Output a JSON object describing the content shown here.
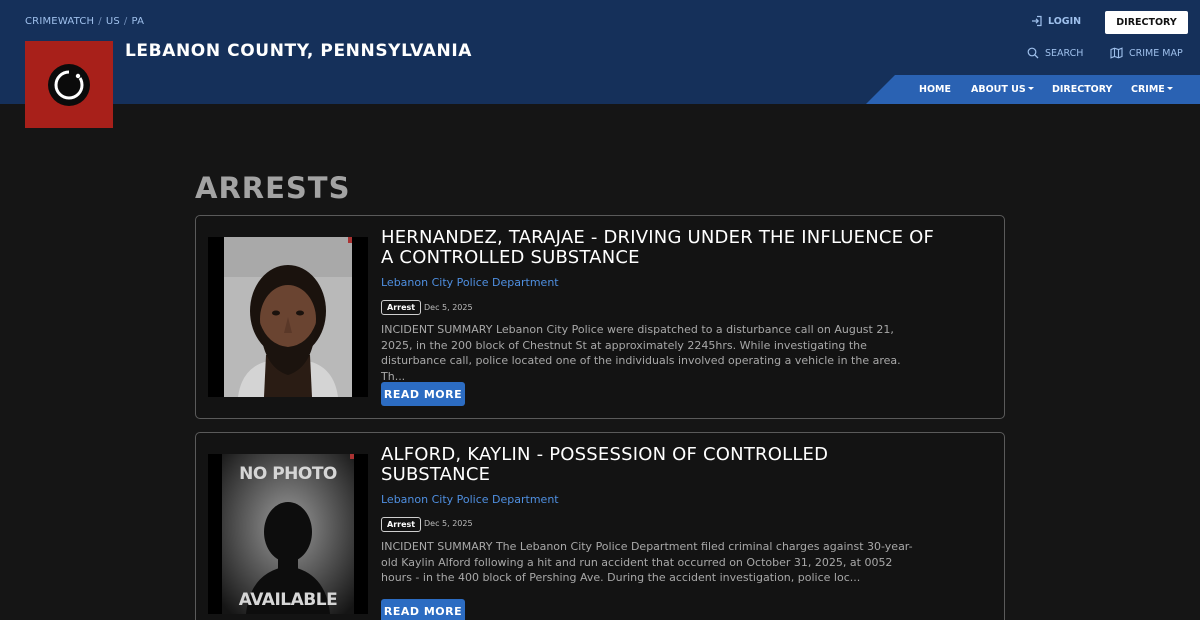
{
  "breadcrumb": [
    "CRIMEWATCH",
    "US",
    "PA"
  ],
  "site": {
    "title": "LEBANON COUNTY, PENNSYLVANIA"
  },
  "header": {
    "login_label": "LOGIN",
    "directory_label": "DIRECTORY",
    "search_label": "SEARCH",
    "crime_map_label": "CRIME MAP"
  },
  "nav": [
    {
      "label": "HOME"
    },
    {
      "label": "ABOUT US"
    },
    {
      "label": "DIRECTORY"
    },
    {
      "label": "CRIME"
    }
  ],
  "page": {
    "title": "ARRESTS"
  },
  "arrests": [
    {
      "title": "HERNANDEZ, TARAJAE - DRIVING UNDER THE INFLUENCE OF A CONTROLLED SUBSTANCE",
      "agency": "Lebanon City Police Department",
      "badge": "Arrest",
      "date": "Dec 5, 2025",
      "summary": "INCIDENT SUMMARY Lebanon City Police were dispatched to a disturbance call on August 21, 2025, in the 200 block of Chestnut St at approximately 2245hrs. While investigating the disturbance call, police located one of the individuals involved operating a vehicle in the area. Th...",
      "read_more": "READ MORE"
    },
    {
      "title": "ALFORD, KAYLIN - POSSESSION OF CONTROLLED SUBSTANCE",
      "agency": "Lebanon City Police Department",
      "badge": "Arrest",
      "date": "Dec 5, 2025",
      "summary": "INCIDENT SUMMARY The Lebanon City Police Department filed criminal charges against 30-year-old Kaylin Alford following a hit and run accident that occurred on October 31, 2025, at 0052 hours - in the 400 block of Pershing Ave. During the accident investigation, police loc...",
      "read_more": "READ MORE",
      "photo_text_top": "NO PHOTO",
      "photo_text_bottom": "AVAILABLE"
    }
  ],
  "colors": {
    "header_bg": "#15305a",
    "nav_bg": "#2a62b3",
    "logo_bg": "#a8201a",
    "link": "#4f8fe0",
    "button": "#2c6cc2"
  }
}
